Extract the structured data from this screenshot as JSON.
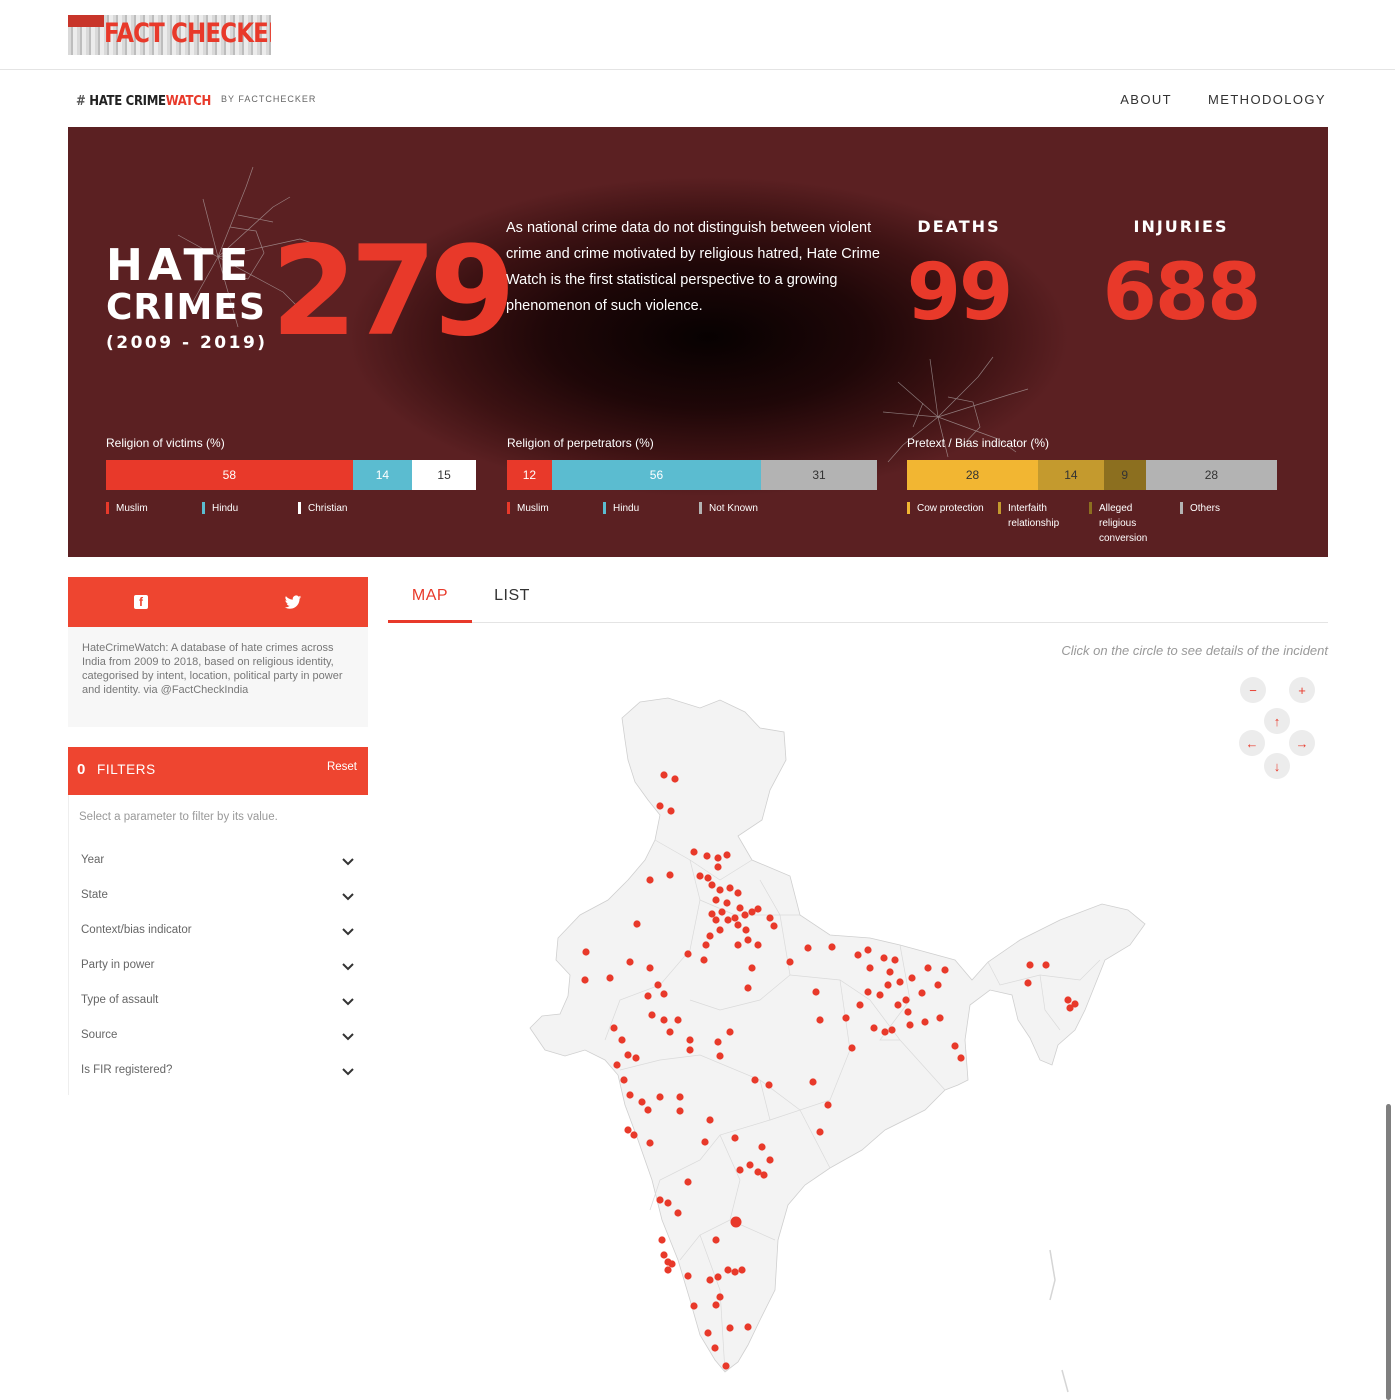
{
  "brand": {
    "factchecker_logo": "FACT CHECKER",
    "hcw_hash": "#",
    "hcw_word1": "HATE CRIME",
    "hcw_word2": "WATCH",
    "byline": "BY FACTCHECKER"
  },
  "nav": {
    "about": "ABOUT",
    "methodology": "METHODOLOGY"
  },
  "hero": {
    "hate": "HATE",
    "crimes": "CRIMES",
    "years": "(2009 - 2019)",
    "total": "279",
    "intro": "As national crime data do not distinguish between violent crime and crime motivated by religious hatred, Hate Crime Watch is the first statistical perspective to a growing phenomenon of such violence.",
    "deaths_label": "DEATHS",
    "deaths_value": "99",
    "injuries_label": "INJURIES",
    "injuries_value": "688"
  },
  "breakdowns": [
    {
      "title": "Religion of victims (%)",
      "segments": [
        {
          "label": "Muslim",
          "value": 58,
          "color": "#e8392a",
          "text_color": "#ffffff"
        },
        {
          "label": "Hindu",
          "value": 14,
          "color": "#5bbcd0",
          "text_color": "#ffffff"
        },
        {
          "label": "Christian",
          "value": 15,
          "color": "#ffffff",
          "text_color": "#333333"
        }
      ]
    },
    {
      "title": "Religion of perpetrators (%)",
      "segments": [
        {
          "label": "Muslim",
          "value": 12,
          "color": "#e8392a",
          "text_color": "#ffffff"
        },
        {
          "label": "Hindu",
          "value": 56,
          "color": "#5bbcd0",
          "text_color": "#ffffff"
        },
        {
          "label": "Not Known",
          "value": 31,
          "color": "#b3b3b3",
          "text_color": "#333333"
        }
      ]
    },
    {
      "title": "Pretext / Bias indicator (%)",
      "segments": [
        {
          "label": "Cow protection",
          "value": 28,
          "color": "#f2b632",
          "text_color": "#333333"
        },
        {
          "label": "Interfaith relationship",
          "value": 14,
          "color": "#c49a2e",
          "text_color": "#333333"
        },
        {
          "label": "Alleged religious conversion",
          "value": 9,
          "color": "#8c6f1f",
          "text_color": "#333333"
        },
        {
          "label": "Others",
          "value": 28,
          "color": "#b3b3b3",
          "text_color": "#333333"
        }
      ]
    }
  ],
  "share": {
    "facebook_icon": "facebook-icon",
    "twitter_icon": "twitter-icon",
    "text": "HateCrimeWatch: A database of hate crimes across India from 2009 to 2018, based on religious identity, categorised by intent, location, political party in power and identity. via @FactCheckIndia"
  },
  "filters": {
    "count": "0",
    "label": "FILTERS",
    "reset": "Reset",
    "hint": "Select a parameter to filter by its value.",
    "items": [
      "Year",
      "State",
      "Context/bias indicator",
      "Party in power",
      "Type of assault",
      "Source",
      "Is FIR registered?"
    ]
  },
  "tabs": {
    "map": "MAP",
    "list": "LIST"
  },
  "map": {
    "hint": "Click on the circle to see details of the incident",
    "controls": {
      "zoom_out": "−",
      "zoom_in": "+",
      "up": "↑",
      "left": "←",
      "right": "→",
      "down": "↓"
    },
    "marker_color": "#e8392a"
  }
}
